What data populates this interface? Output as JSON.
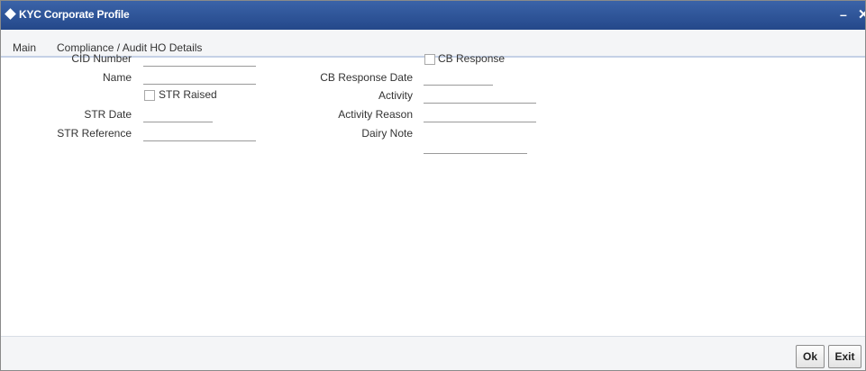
{
  "window": {
    "title": "KYC Corporate Profile",
    "minimize_glyph": "–",
    "close_glyph": "✕"
  },
  "tabs": [
    {
      "label": "Main"
    },
    {
      "label": "Compliance / Audit HO Details"
    }
  ],
  "form": {
    "cid_number": {
      "label": "CID Number",
      "value": ""
    },
    "name": {
      "label": "Name",
      "value": ""
    },
    "str_raised": {
      "label": "STR Raised",
      "checked": false
    },
    "str_date": {
      "label": "STR Date",
      "value": ""
    },
    "str_reference": {
      "label": "STR Reference",
      "value": ""
    },
    "cb_response": {
      "label": "CB Response",
      "checked": false
    },
    "cb_response_date": {
      "label": "CB Response Date",
      "value": ""
    },
    "activity": {
      "label": "Activity",
      "value": ""
    },
    "activity_reason": {
      "label": "Activity Reason",
      "value": ""
    },
    "dairy_note": {
      "label": "Dairy Note",
      "value": ""
    }
  },
  "footer": {
    "ok_label": "Ok",
    "exit_label": "Exit"
  },
  "colors": {
    "titlebar": "#2e55a0",
    "tab_underline": "#c5d1e6"
  }
}
